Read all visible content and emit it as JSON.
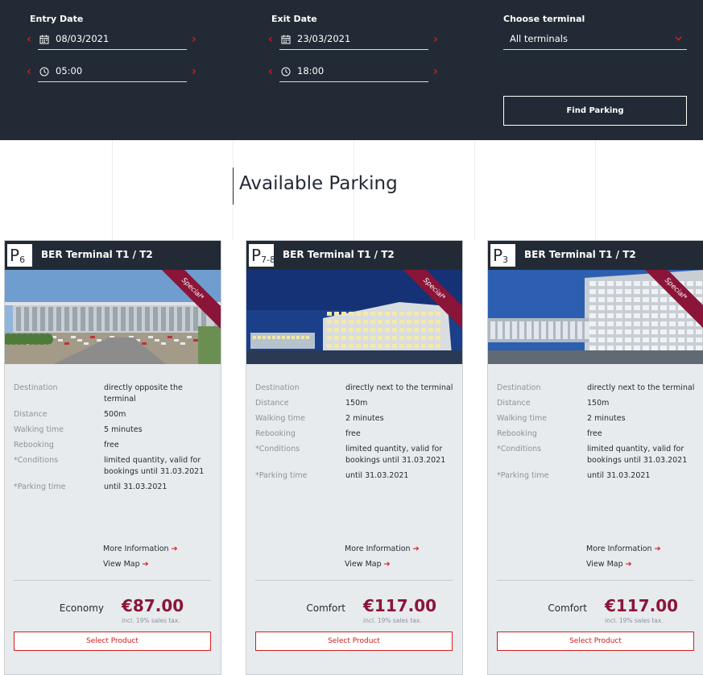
{
  "search": {
    "entry": {
      "label": "Entry Date",
      "date": "08/03/2021",
      "time": "05:00"
    },
    "exit": {
      "label": "Exit Date",
      "date": "23/03/2021",
      "time": "18:00"
    },
    "terminal": {
      "label": "Choose terminal",
      "value": "All terminals"
    },
    "find_label": "Find Parking"
  },
  "section_title": "Available Parking",
  "card_labels": {
    "destination": "Destination",
    "distance": "Distance",
    "walking_time": "Walking time",
    "rebooking": "Rebooking",
    "conditions": "*Conditions",
    "parking_time": "*Parking time",
    "more_info": "More Information",
    "view_map": "View Map",
    "tax_note": "incl. 19% sales tax.",
    "select_label": "Select Product",
    "ribbon": "Special*"
  },
  "cards": [
    {
      "badge": "P",
      "badge_sub": "6",
      "name": "BER Terminal T1 / T2",
      "destination": "directly opposite the terminal",
      "distance": "500m",
      "walking_time": "5 minutes",
      "rebooking": "free",
      "conditions": "limited quantity, valid for bookings until 31.03.2021",
      "parking_time": "until 31.03.2021",
      "tier": "Economy",
      "price": "€87.00"
    },
    {
      "badge": "P",
      "badge_sub": "7-8",
      "name": "BER Terminal T1 / T2",
      "destination": "directly next to the terminal",
      "distance": "150m",
      "walking_time": "2 minutes",
      "rebooking": "free",
      "conditions": "limited quantity, valid for bookings until 31.03.2021",
      "parking_time": "until 31.03.2021",
      "tier": "Comfort",
      "price": "€117.00"
    },
    {
      "badge": "P",
      "badge_sub": "3",
      "name": "BER Terminal T1 / T2",
      "destination": "directly next to the terminal",
      "distance": "150m",
      "walking_time": "2 minutes",
      "rebooking": "free",
      "conditions": "limited quantity, valid for bookings until 31.03.2021",
      "parking_time": "until 31.03.2021",
      "tier": "Comfort",
      "price": "€117.00"
    }
  ],
  "colors": {
    "navy": "#222b35",
    "accent_red": "#d21b1b",
    "price_burgundy": "#8a1538",
    "card_bg": "#e8ebed"
  },
  "icons": {
    "date": "calendar-icon",
    "time": "clock-icon",
    "prev": "chevron-left-icon",
    "next": "chevron-right-icon",
    "dropdown": "chevron-down-icon",
    "link": "arrow-right-icon"
  }
}
